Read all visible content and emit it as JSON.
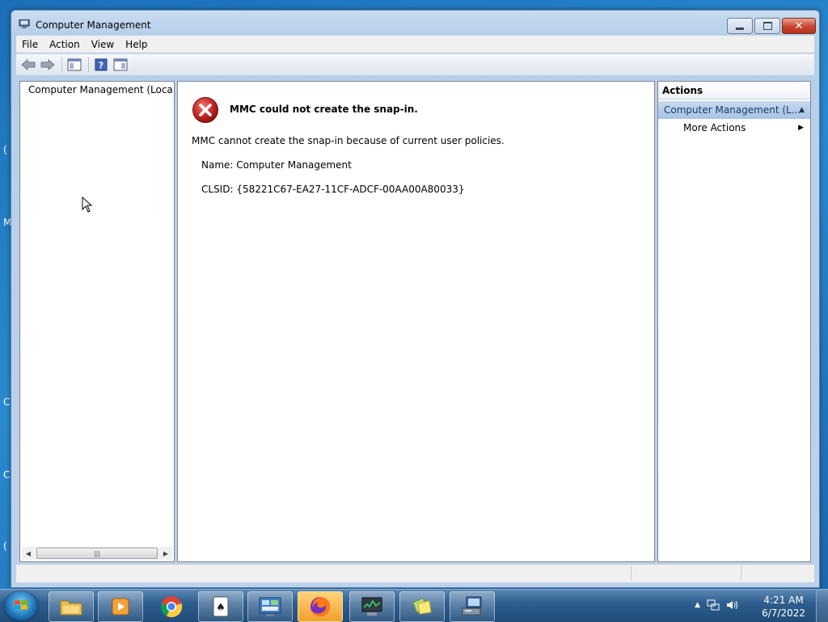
{
  "window": {
    "title": "Computer Management"
  },
  "menu": [
    "File",
    "Action",
    "View",
    "Help"
  ],
  "tree": {
    "root_label": "Computer Management (Local"
  },
  "error": {
    "title": "MMC could not create the snap-in.",
    "message": "MMC cannot create the snap-in because of current user policies.",
    "name_line": "Name: Computer Management",
    "clsid_line": "CLSID: {58221C67-EA27-11CF-ADCF-00AA00A80033}"
  },
  "actions": {
    "header": "Actions",
    "group_label": "Computer Management (L...",
    "item_label": "More Actions"
  },
  "taskbar": {
    "apps": [
      "file-explorer",
      "media-player",
      "chrome",
      "solitaire",
      "control-panel",
      "firefox",
      "task-manager",
      "sticky-notes",
      "computer-management"
    ],
    "active_app": "firefox"
  },
  "clock": {
    "time": "4:21 AM",
    "date": "6/7/2022"
  },
  "colors": {
    "accent": "#1f4b78",
    "error_red": "#c62828",
    "selected_group": "#a8c4e5"
  }
}
